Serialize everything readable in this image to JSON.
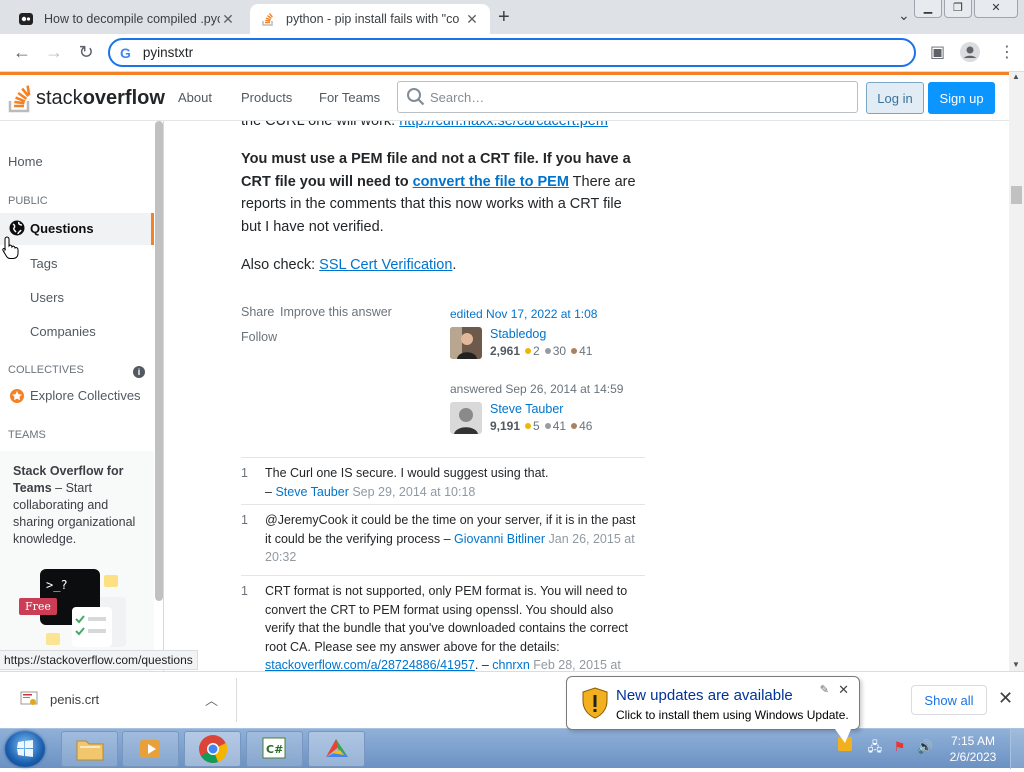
{
  "browser": {
    "tabs": [
      {
        "title": "How to decompile compiled .pyc",
        "active": false
      },
      {
        "title": "python - pip install fails with \"co",
        "active": true
      }
    ],
    "address": "pyinstxtr",
    "new_tab_symbol": "+",
    "status_url": "https://stackoverflow.com/questions"
  },
  "so_header": {
    "logo_light": "stack",
    "logo_bold": "overflow",
    "nav": [
      "About",
      "Products",
      "For Teams"
    ],
    "search_placeholder": "Search…",
    "login": "Log in",
    "signup": "Sign up"
  },
  "sidebar": {
    "home": "Home",
    "public_label": "PUBLIC",
    "questions": "Questions",
    "tags": "Tags",
    "users": "Users",
    "companies": "Companies",
    "collectives_label": "COLLECTIVES",
    "explore_collectives": "Explore Collectives",
    "teams_label": "TEAMS",
    "teams_title": "Stack Overflow for Teams",
    "teams_body": " – Start collaborating and sharing organizational knowledge.",
    "free_badge": "Free"
  },
  "answer": {
    "top_cut_text": "the CURL one will work: ",
    "top_cut_link": "http://curl.haxx.se/ca/cacert.pem",
    "bold_text_1": "You must use a PEM file and not a CRT file. If you have a CRT file you will need to ",
    "bold_link": "convert the file to PEM",
    "after_bold": " There are reports in the comments that this now works with a CRT file but I have not verified.",
    "also_check": "Also check: ",
    "also_link": "SSL Cert Verification",
    "also_end": ".",
    "share": "Share",
    "improve": "Improve this answer",
    "follow": "Follow",
    "edited": "edited Nov 17, 2022 at 1:08",
    "editor": {
      "name": "Stabledog",
      "rep": "2,961",
      "gold": "2",
      "silver": "30",
      "bronze": "41"
    },
    "answered": "answered Sep 26, 2014 at 14:59",
    "author": {
      "name": "Steve Tauber",
      "rep": "9,191",
      "gold": "5",
      "silver": "41",
      "bronze": "46"
    }
  },
  "comments": [
    {
      "score": "1",
      "text": "The Curl one IS secure. I would suggest using that.",
      "sep": " – ",
      "user": "Steve Tauber",
      "date": " Sep 29, 2014 at 10:18"
    },
    {
      "score": "1",
      "text": "@JeremyCook it could be the time on your server, if it is in the past it could be the verifying process",
      "sep": " – ",
      "user": "Giovanni Bitliner",
      "date": " Jan 26, 2015 at 20:32"
    },
    {
      "score": "1",
      "text": "CRT format is not supported, only PEM format is. You will need to convert the CRT to PEM format using openssl. You should also verify that the bundle that you've downloaded contains the correct root CA. Please see my answer above for the details: ",
      "link": "stackoverflow.com/a/28724886/41957",
      "sep": ". – ",
      "user": "chnrxn",
      "date": " Feb 28, 2015 at"
    }
  ],
  "downloads": {
    "file": "penis.crt",
    "show_all": "Show all"
  },
  "balloon": {
    "title": "New updates are available",
    "subtitle": "Click to install them using Windows Update."
  },
  "taskbar": {
    "time": "7:15 AM",
    "date": "2/6/2023"
  },
  "colors": {
    "so_orange": "#f48225",
    "so_blue": "#0a95ff",
    "link": "#0074cc",
    "chrome_blue": "#1a73e8"
  }
}
